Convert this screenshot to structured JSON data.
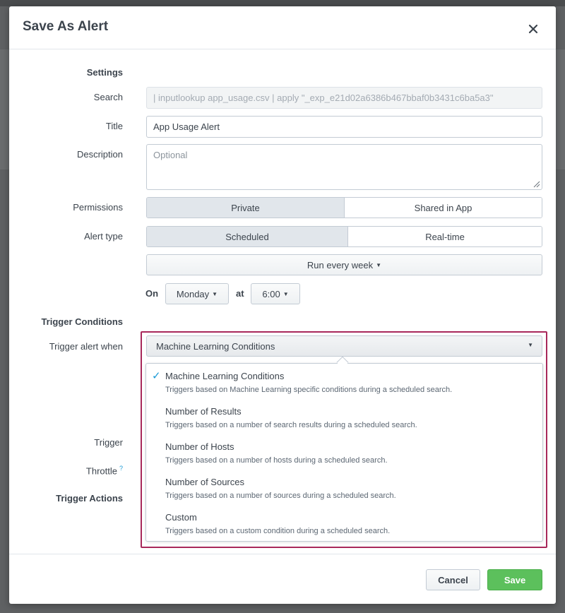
{
  "colors": {
    "accent_highlight": "#a8285a",
    "save_green": "#5cc05c",
    "check_blue": "#1a9ad6"
  },
  "dialog": {
    "title": "Save As Alert",
    "close_icon": "close-icon"
  },
  "settings": {
    "section_label": "Settings",
    "search": {
      "label": "Search",
      "value": "| inputlookup app_usage.csv | apply \"_exp_e21d02a6386b467bbaf0b3431c6ba5a3\""
    },
    "title": {
      "label": "Title",
      "value": "App Usage Alert"
    },
    "description": {
      "label": "Description",
      "placeholder": "Optional"
    },
    "permissions": {
      "label": "Permissions",
      "options": [
        "Private",
        "Shared in App"
      ],
      "selected": "Private"
    },
    "alert_type": {
      "label": "Alert type",
      "options": [
        "Scheduled",
        "Real-time"
      ],
      "selected": "Scheduled"
    },
    "schedule": {
      "frequency": "Run every week",
      "on_label": "On",
      "day": "Monday",
      "at_label": "at",
      "time": "6:00"
    }
  },
  "trigger_conditions": {
    "section_label": "Trigger Conditions",
    "trigger_when_label": "Trigger alert when",
    "selected": "Machine Learning Conditions",
    "options": [
      {
        "title": "Machine Learning Conditions",
        "desc": "Triggers based on Machine Learning specific conditions during a scheduled search.",
        "checked": true
      },
      {
        "title": "Number of Results",
        "desc": "Triggers based on a number of search results during a scheduled search.",
        "checked": false
      },
      {
        "title": "Number of Hosts",
        "desc": "Triggers based on a number of hosts during a scheduled search.",
        "checked": false
      },
      {
        "title": "Number of Sources",
        "desc": "Triggers based on a number of sources during a scheduled search.",
        "checked": false
      },
      {
        "title": "Custom",
        "desc": "Triggers based on a custom condition during a scheduled search.",
        "checked": false
      }
    ],
    "trigger_label": "Trigger",
    "throttle_label": "Throttle",
    "throttle_help": "?"
  },
  "trigger_actions": {
    "section_label": "Trigger Actions"
  },
  "footer": {
    "cancel_label": "Cancel",
    "save_label": "Save"
  }
}
